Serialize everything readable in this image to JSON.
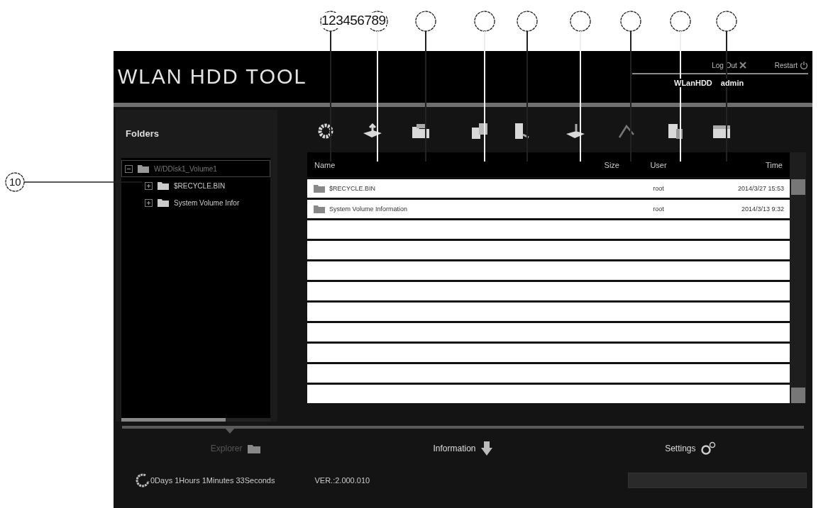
{
  "callouts": {
    "top_numbers": "123456789",
    "markers": [
      {
        "kind": "toolbar"
      },
      {
        "kind": "toolbar"
      },
      {
        "kind": "toolbar"
      },
      {
        "kind": "toolbar"
      },
      {
        "kind": "toolbar"
      },
      {
        "kind": "toolbar"
      },
      {
        "kind": "toolbar"
      },
      {
        "kind": "toolbar"
      },
      {
        "kind": "toolbar"
      }
    ],
    "side_number": "10"
  },
  "header": {
    "title": "WLAN HDD TOOL",
    "logout": "Log Out",
    "restart": "Restart",
    "device": "WLanHDD",
    "user": "admin"
  },
  "folders": {
    "title": "Folders",
    "tree": [
      {
        "label": "W/DDisk1_Volume1",
        "selected": true,
        "expanded": true,
        "children": [
          {
            "label": "$RECYCLE.BIN",
            "selected": false,
            "expanded": false
          },
          {
            "label": "System Volume Infor",
            "selected": false,
            "expanded": false
          }
        ]
      }
    ]
  },
  "toolbar": [
    {
      "kind": "gear"
    },
    {
      "kind": "upload"
    },
    {
      "kind": "folder"
    },
    {
      "kind": "copy"
    },
    {
      "kind": "move"
    },
    {
      "kind": "download"
    },
    {
      "kind": "pick"
    },
    {
      "kind": "rename"
    },
    {
      "kind": "archive"
    }
  ],
  "table": {
    "columns": [
      "Name",
      "Size",
      "User",
      "Time"
    ],
    "rows": [
      {
        "kind": "folder",
        "name": "$RECYCLE.BIN",
        "user": "root",
        "time": "2014/3/27 15:53"
      },
      {
        "kind": "folder",
        "name": "System Volume Information",
        "user": "root",
        "time": "2014/3/13 9:32"
      },
      {
        "kind": "blank"
      },
      {
        "kind": "blank"
      },
      {
        "kind": "blank"
      },
      {
        "kind": "blank"
      },
      {
        "kind": "blank"
      },
      {
        "kind": "blank"
      },
      {
        "kind": "blank"
      },
      {
        "kind": "blank"
      },
      {
        "kind": "blank"
      }
    ]
  },
  "nav": [
    {
      "label": "Explorer",
      "kind": "folder",
      "selected": true
    },
    {
      "label": "Information",
      "kind": "arrow",
      "selected": false
    },
    {
      "label": "Settings",
      "kind": "gears",
      "selected": false
    }
  ],
  "status": {
    "uptime": "0Days 1Hours 1Minutes 33Seconds",
    "version": "VER.:2.000.010"
  }
}
